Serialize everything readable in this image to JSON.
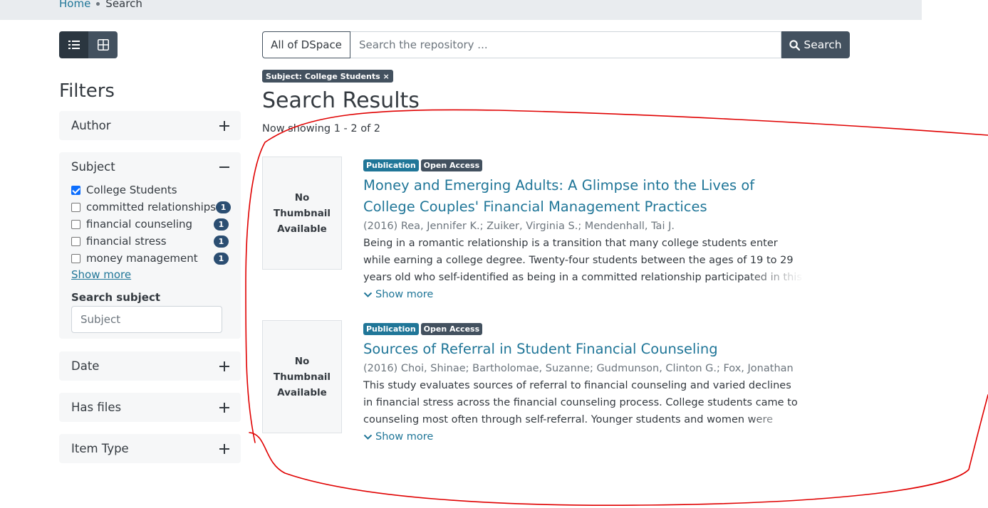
{
  "breadcrumb": {
    "home": "Home",
    "current": "Search"
  },
  "view_toggle": {
    "list_icon": "list-icon",
    "grid_icon": "grid-icon"
  },
  "filters": {
    "title": "Filters",
    "author": "Author",
    "subject": {
      "label": "Subject",
      "options": [
        {
          "label": "College Students",
          "checked": true
        },
        {
          "label": "committed relationships",
          "count": "1"
        },
        {
          "label": "financial counseling",
          "count": "1"
        },
        {
          "label": "financial stress",
          "count": "1"
        },
        {
          "label": "money management",
          "count": "1"
        }
      ],
      "show_more": "Show more",
      "search_label": "Search subject",
      "search_placeholder": "Subject"
    },
    "date": "Date",
    "has_files": "Has files",
    "item_type": "Item Type"
  },
  "search": {
    "scope": "All of DSpace",
    "placeholder": "Search the repository ...",
    "button": "Search"
  },
  "active_filter": "Subject: College Students ×",
  "results": {
    "title": "Search Results",
    "showing": "Now showing 1 - 2 of 2",
    "items": [
      {
        "thumbnail": "No Thumbnail Available",
        "type": "Publication",
        "access": "Open Access",
        "title": "Money and Emerging Adults: A Glimpse into the Lives of College Couples' Financial Management Practices",
        "authors": "(2016) Rea, Jennifer K.; Zuiker, Virginia S.; Mendenhall, Tai J.",
        "abstract": "Being in a romantic relationship is a transition that many college students enter while earning a college degree. Twenty-four students between the ages of 19 to 29 years old who self-identified as being in a committed relationship participated in this",
        "show_more": "Show more"
      },
      {
        "thumbnail": "No Thumbnail Available",
        "type": "Publication",
        "access": "Open Access",
        "title": "Sources of Referral in Student Financial Counseling",
        "authors": "(2016) Choi, Shinae; Bartholomae, Suzanne; Gudmunson, Clinton G.; Fox, Jonathan",
        "abstract": "This study evaluates sources of referral to financial counseling and varied declines in financial stress across the financial counseling process. College students came to counseling most often through self-referral. Younger students and women were",
        "show_more": "Show more"
      }
    ]
  },
  "colors": {
    "accent": "#207698",
    "dark": "#43515f",
    "annotation": "#e00000"
  }
}
